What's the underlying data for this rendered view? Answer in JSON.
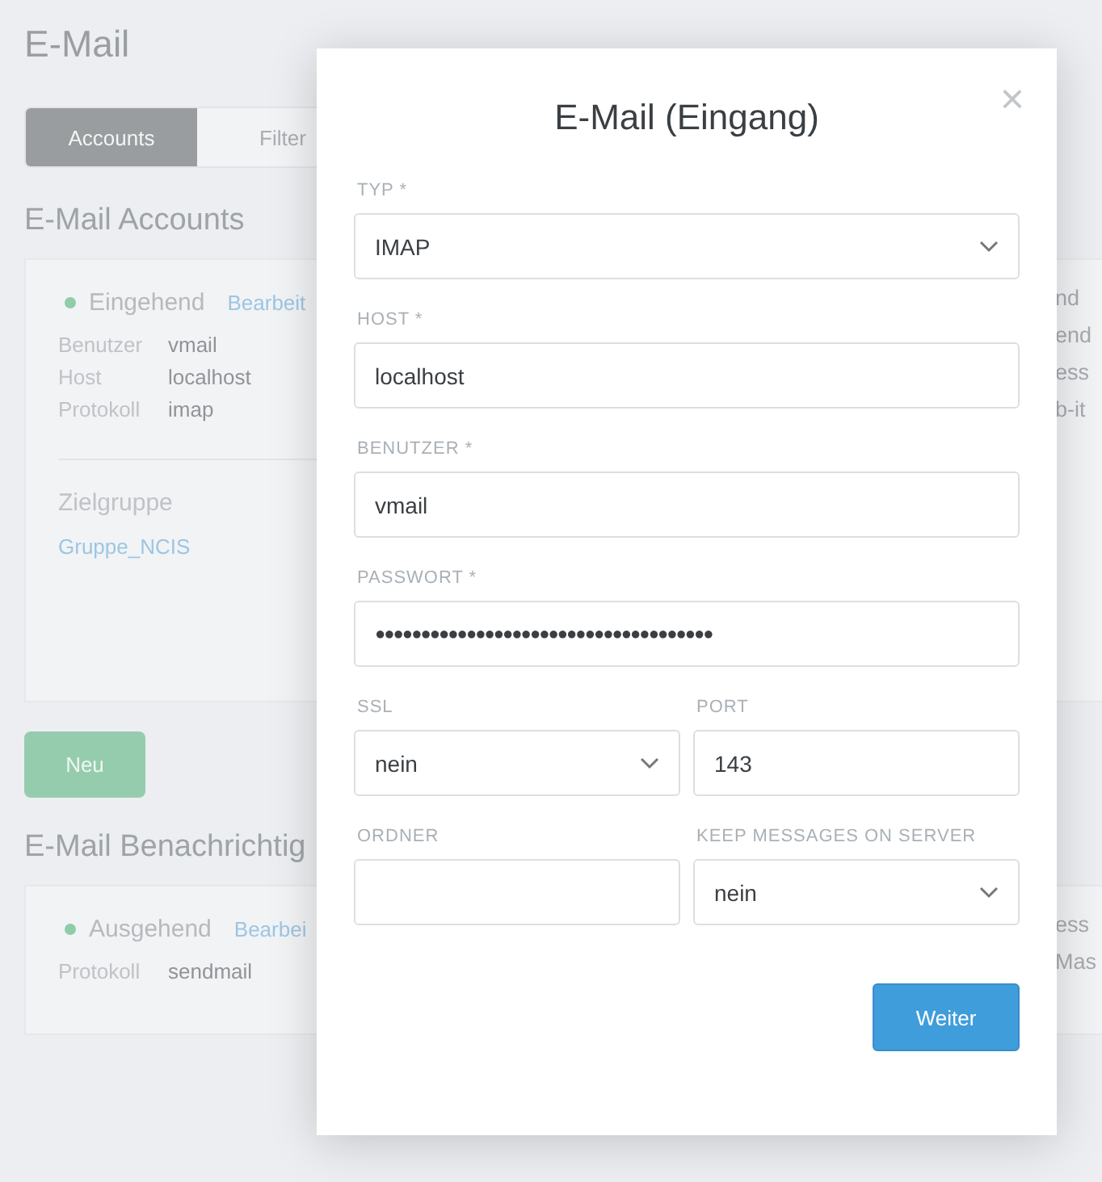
{
  "page": {
    "title": "E-Mail",
    "tabs": [
      {
        "label": "Accounts",
        "selected": true
      },
      {
        "label": "Filter",
        "selected": false
      }
    ],
    "sections": [
      {
        "heading": "E-Mail Accounts",
        "status": "Eingehend",
        "edit_link": "Bearbeit",
        "details": [
          {
            "label": "Benutzer",
            "value": "vmail"
          },
          {
            "label": "Host",
            "value": "localhost"
          },
          {
            "label": "Protokoll",
            "value": "imap"
          }
        ],
        "group_label": "Zielgruppe",
        "group_link": "Gruppe_NCIS",
        "right_texts": [
          "nd",
          "end",
          "ess",
          "b-it"
        ],
        "button": "Neu"
      },
      {
        "heading": "E-Mail Benachrichtig",
        "status": "Ausgehend",
        "edit_link": "Bearbei",
        "details": [
          {
            "label": "Protokoll",
            "value": "sendmail"
          }
        ],
        "right_texts": [
          "ess",
          "Mas"
        ]
      }
    ]
  },
  "modal": {
    "title": "E-Mail (Eingang)",
    "close": "×",
    "rows": [
      [
        {
          "label": "TYP *",
          "kind": "select",
          "value": "IMAP"
        }
      ],
      [
        {
          "label": "HOST *",
          "kind": "input",
          "value": "localhost"
        }
      ],
      [
        {
          "label": "BENUTZER *",
          "kind": "input",
          "value": "vmail"
        }
      ],
      [
        {
          "label": "PASSWORT *",
          "kind": "password",
          "value": "●●●●●●●●●●●●●●●●●●●●●●●●●●●●●●●●●●●●●"
        }
      ],
      [
        {
          "label": "SSL",
          "kind": "select",
          "value": "nein"
        },
        {
          "label": "PORT",
          "kind": "input",
          "value": "143"
        }
      ],
      [
        {
          "label": "ORDNER",
          "kind": "input"
        },
        {
          "label": "KEEP MESSAGES ON SERVER",
          "kind": "select",
          "value": "nein"
        }
      ]
    ],
    "submit": "Weiter"
  }
}
